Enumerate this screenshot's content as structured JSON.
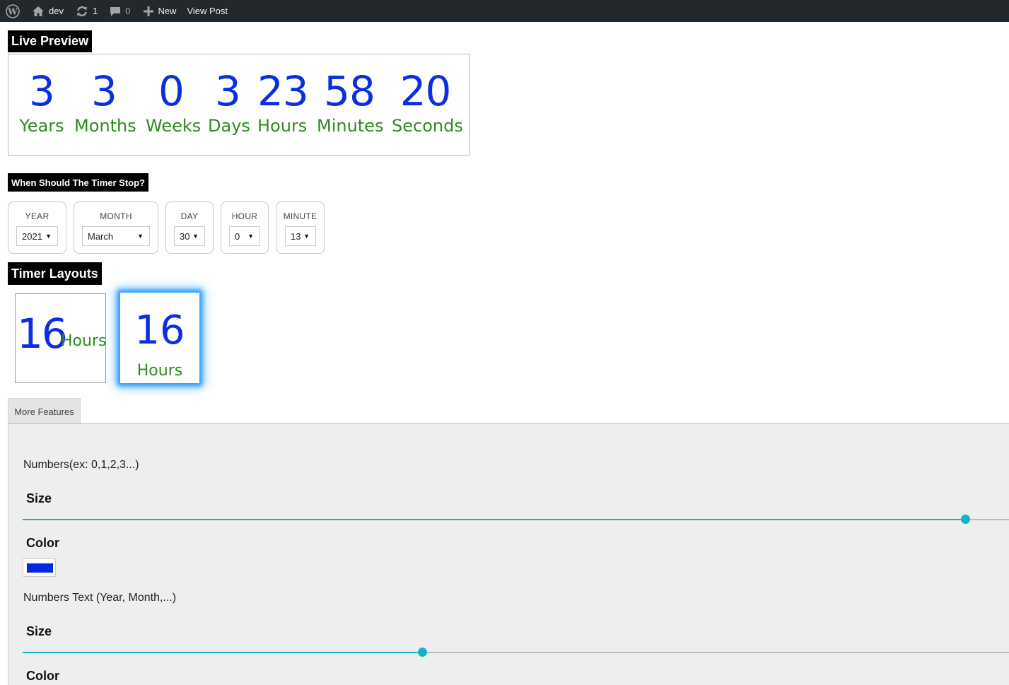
{
  "admin_bar": {
    "site_name": "dev",
    "updates_count": "1",
    "comments_count": "0",
    "new_label": "New",
    "view_post_label": "View Post"
  },
  "live_preview": {
    "heading": "Live Preview",
    "units": [
      {
        "value": "3",
        "label": "Years"
      },
      {
        "value": "3",
        "label": "Months"
      },
      {
        "value": "0",
        "label": "Weeks"
      },
      {
        "value": "3",
        "label": "Days"
      },
      {
        "value": "23",
        "label": "Hours"
      },
      {
        "value": "58",
        "label": "Minutes"
      },
      {
        "value": "20",
        "label": "Seconds"
      }
    ],
    "number_color": "#0b2ee0",
    "label_color": "#2e8b1f"
  },
  "stop_time": {
    "heading": "When Should The Timer Stop?",
    "fields": [
      {
        "caption": "YEAR",
        "value": "2021"
      },
      {
        "caption": "MONTH",
        "value": "March"
      },
      {
        "caption": "DAY",
        "value": "30"
      },
      {
        "caption": "HOUR",
        "value": "0"
      },
      {
        "caption": "MINUTE",
        "value": "13"
      }
    ]
  },
  "timer_layouts": {
    "heading": "Timer Layouts",
    "layouts": [
      {
        "value": "16",
        "label": "Hours",
        "selected": false
      },
      {
        "value": "16",
        "label": "Hours",
        "selected": true
      }
    ]
  },
  "more_features": {
    "tab_label": "More Features",
    "numbers_section_title": "Numbers(ex: 0,1,2,3...)",
    "numbers_size_label": "Size",
    "numbers_size_fraction": 0.955,
    "numbers_color_label": "Color",
    "numbers_color": "#0028e6",
    "text_section_title": "Numbers Text (Year, Month,...)",
    "text_size_label": "Size",
    "text_size_fraction": 0.405,
    "text_color_label": "Color",
    "slider_color": "#11b3c8"
  }
}
